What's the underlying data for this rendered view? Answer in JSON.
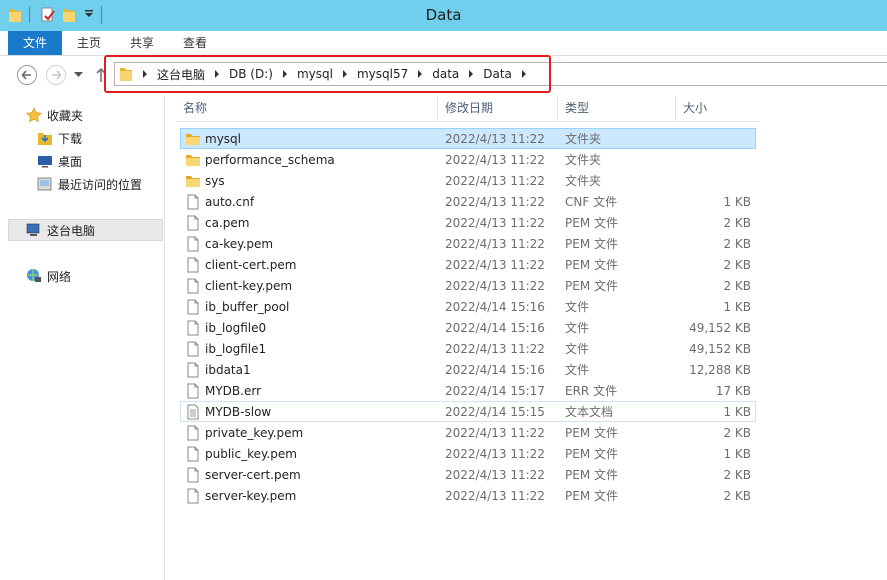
{
  "window": {
    "title": "Data"
  },
  "ribbon": {
    "tabs": [
      "文件",
      "主页",
      "共享",
      "查看"
    ]
  },
  "address": {
    "crumbs": [
      "这台电脑",
      "DB (D:)",
      "mysql",
      "mysql57",
      "data",
      "Data"
    ]
  },
  "navpane": {
    "favorites": "收藏夹",
    "downloads": "下载",
    "desktop": "桌面",
    "recent": "最近访问的位置",
    "this_pc": "这台电脑",
    "network": "网络"
  },
  "columns": {
    "name": "名称",
    "date": "修改日期",
    "type": "类型",
    "size": "大小"
  },
  "files": [
    {
      "name": "mysql",
      "date": "2022/4/13 11:22",
      "type": "文件夹",
      "size": "",
      "icon": "folder-icon"
    },
    {
      "name": "performance_schema",
      "date": "2022/4/13 11:22",
      "type": "文件夹",
      "size": "",
      "icon": "folder-icon"
    },
    {
      "name": "sys",
      "date": "2022/4/13 11:22",
      "type": "文件夹",
      "size": "",
      "icon": "folder-icon"
    },
    {
      "name": "auto.cnf",
      "date": "2022/4/13 11:22",
      "type": "CNF 文件",
      "size": "1 KB",
      "icon": "file-icon"
    },
    {
      "name": "ca.pem",
      "date": "2022/4/13 11:22",
      "type": "PEM 文件",
      "size": "2 KB",
      "icon": "file-icon"
    },
    {
      "name": "ca-key.pem",
      "date": "2022/4/13 11:22",
      "type": "PEM 文件",
      "size": "2 KB",
      "icon": "file-icon"
    },
    {
      "name": "client-cert.pem",
      "date": "2022/4/13 11:22",
      "type": "PEM 文件",
      "size": "2 KB",
      "icon": "file-icon"
    },
    {
      "name": "client-key.pem",
      "date": "2022/4/13 11:22",
      "type": "PEM 文件",
      "size": "2 KB",
      "icon": "file-icon"
    },
    {
      "name": "ib_buffer_pool",
      "date": "2022/4/14 15:16",
      "type": "文件",
      "size": "1 KB",
      "icon": "file-icon"
    },
    {
      "name": "ib_logfile0",
      "date": "2022/4/14 15:16",
      "type": "文件",
      "size": "49,152 KB",
      "icon": "file-icon"
    },
    {
      "name": "ib_logfile1",
      "date": "2022/4/13 11:22",
      "type": "文件",
      "size": "49,152 KB",
      "icon": "file-icon"
    },
    {
      "name": "ibdata1",
      "date": "2022/4/14 15:16",
      "type": "文件",
      "size": "12,288 KB",
      "icon": "file-icon"
    },
    {
      "name": "MYDB.err",
      "date": "2022/4/14 15:17",
      "type": "ERR 文件",
      "size": "17 KB",
      "icon": "file-icon"
    },
    {
      "name": "MYDB-slow",
      "date": "2022/4/14 15:15",
      "type": "文本文档",
      "size": "1 KB",
      "icon": "text-file-icon"
    },
    {
      "name": "private_key.pem",
      "date": "2022/4/13 11:22",
      "type": "PEM 文件",
      "size": "2 KB",
      "icon": "file-icon"
    },
    {
      "name": "public_key.pem",
      "date": "2022/4/13 11:22",
      "type": "PEM 文件",
      "size": "1 KB",
      "icon": "file-icon"
    },
    {
      "name": "server-cert.pem",
      "date": "2022/4/13 11:22",
      "type": "PEM 文件",
      "size": "2 KB",
      "icon": "file-icon"
    },
    {
      "name": "server-key.pem",
      "date": "2022/4/13 11:22",
      "type": "PEM 文件",
      "size": "2 KB",
      "icon": "file-icon"
    }
  ],
  "colors": {
    "title_bar": "#6fcfec",
    "file_tab": "#1979ca",
    "selection": "#cce8ff",
    "highlight_box": "#e21d1d"
  }
}
